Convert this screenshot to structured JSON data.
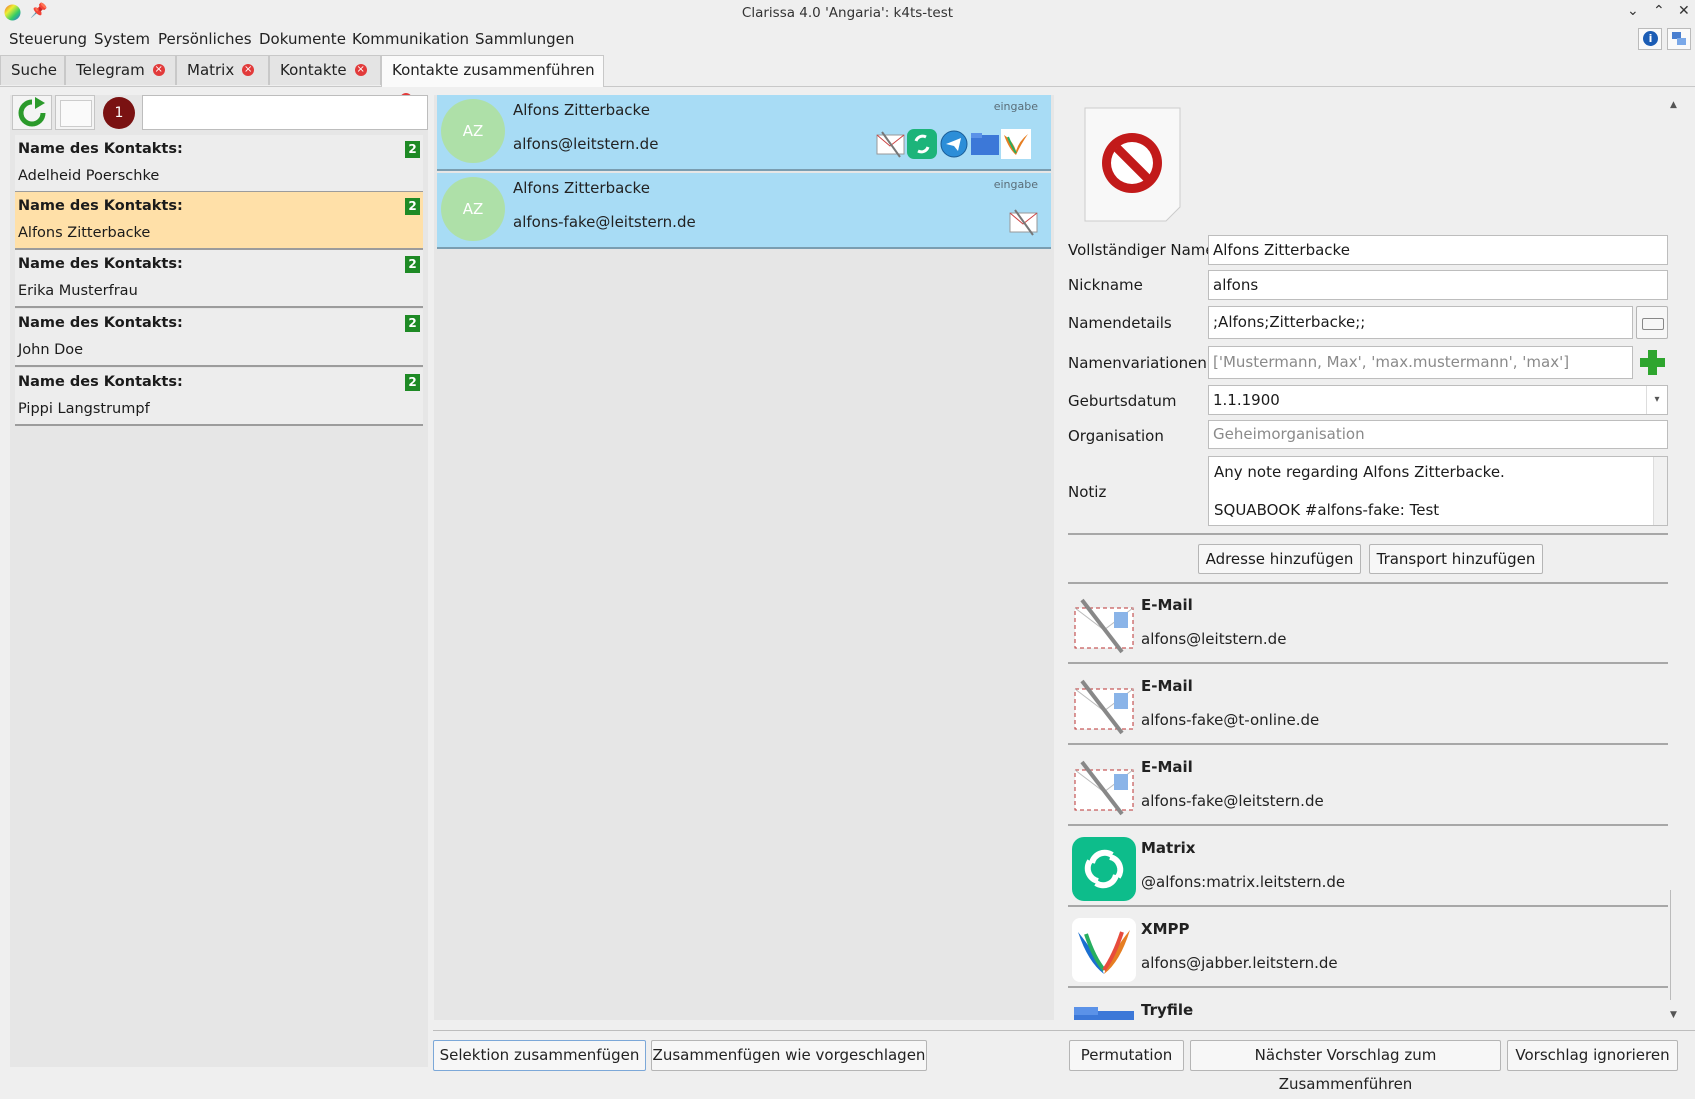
{
  "window": {
    "title": "Clarissa 4.0 'Angaria': k4ts-test"
  },
  "menu": [
    "Steuerung",
    "System",
    "Persönliches",
    "Dokumente",
    "Kommunikation",
    "Sammlungen"
  ],
  "tabs": [
    {
      "label": "Suche",
      "closable": false
    },
    {
      "label": "Telegram",
      "closable": true
    },
    {
      "label": "Matrix",
      "closable": true
    },
    {
      "label": "Kontakte",
      "closable": true
    },
    {
      "label": "Kontakte zusammenführen",
      "closable": true,
      "active": true
    }
  ],
  "left": {
    "badge_count": "1",
    "search_value": "",
    "contact_label": "Name des Kontakts:",
    "contacts": [
      {
        "name": "Adelheid Poerschke",
        "count": "2"
      },
      {
        "name": "Alfons Zitterbacke",
        "count": "2",
        "selected": true
      },
      {
        "name": "Erika Musterfrau",
        "count": "2"
      },
      {
        "name": "John Doe",
        "count": "2"
      },
      {
        "name": "Pippi Langstrumpf",
        "count": "2"
      }
    ]
  },
  "middle": {
    "cards": [
      {
        "initials": "AZ",
        "name": "Alfons Zitterbacke",
        "email": "alfons@leitstern.de",
        "tag": "eingabe",
        "services": [
          "mail-icon",
          "matrix-icon",
          "telegram-icon",
          "folder-icon",
          "xmpp-icon"
        ]
      },
      {
        "initials": "AZ",
        "name": "Alfons Zitterbacke",
        "email": "alfons-fake@leitstern.de",
        "tag": "eingabe",
        "services": [
          "mail-icon"
        ]
      }
    ]
  },
  "details": {
    "fields": {
      "full_name": {
        "label": "Vollständiger Name",
        "value": "Alfons Zitterbacke"
      },
      "nickname": {
        "label": "Nickname",
        "value": "alfons"
      },
      "name_details": {
        "label": "Namendetails",
        "value": ";Alfons;Zitterbacke;;"
      },
      "name_variations": {
        "label": "Namenvariationen",
        "placeholder": "['Mustermann, Max', 'max.mustermann', 'max']"
      },
      "birthday": {
        "label": "Geburtsdatum",
        "value": "1.1.1900"
      },
      "organisation": {
        "label": "Organisation",
        "placeholder": "Geheimorganisation"
      },
      "note": {
        "label": "Notiz",
        "line1": "Any note regarding Alfons Zitterbacke.",
        "line2": "SQUABOOK #alfons-fake: Test"
      }
    },
    "add_address": "Adresse hinzufügen",
    "add_transport": "Transport hinzufügen",
    "addresses": [
      {
        "type": "E-Mail",
        "value": "alfons@leitstern.de",
        "icon": "mail-icon"
      },
      {
        "type": "E-Mail",
        "value": "alfons-fake@t-online.de",
        "icon": "mail-icon"
      },
      {
        "type": "E-Mail",
        "value": "alfons-fake@leitstern.de",
        "icon": "mail-icon"
      },
      {
        "type": "Matrix",
        "value": "@alfons:matrix.leitstern.de",
        "icon": "matrix-icon"
      },
      {
        "type": "XMPP",
        "value": "alfons@jabber.leitstern.de",
        "icon": "xmpp-icon"
      },
      {
        "type": "Tryfile",
        "value": "",
        "icon": "folder-icon"
      }
    ]
  },
  "bottom": {
    "merge_selection": "Selektion zusammenfügen",
    "merge_suggested": "Zusammenfügen wie vorgeschlagen",
    "permutation": "Permutation",
    "next_suggestion": "Nächster Vorschlag zum Zusammenführen",
    "ignore_suggestion": "Vorschlag ignorieren"
  }
}
